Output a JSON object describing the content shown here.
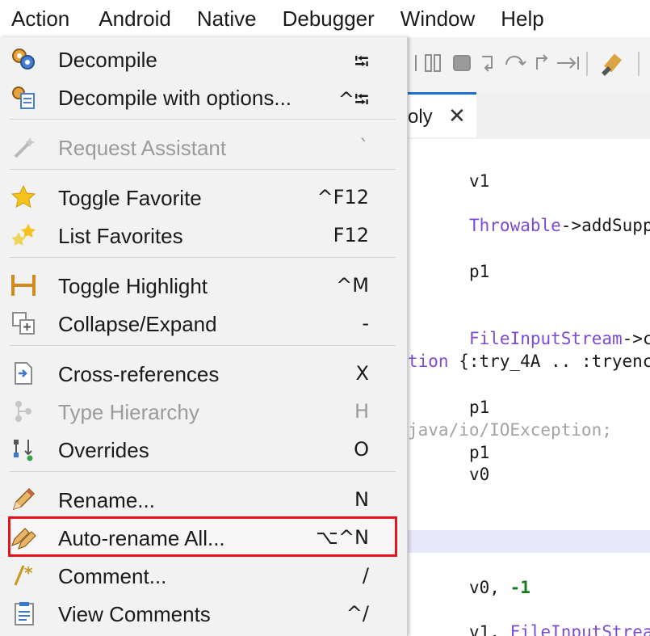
{
  "menubar": {
    "items": [
      "Action",
      "Android",
      "Native",
      "Debugger",
      "Window",
      "Help"
    ]
  },
  "tab": {
    "label": "oly",
    "close": "✕"
  },
  "editor": {
    "lines": {
      "l1": "v1",
      "l2a": "Throwable",
      "l2b": "->addSupp",
      "l3": "p1",
      "l4a": "FileInputStream",
      "l4b": "->c",
      "l5a": "tion",
      "l5b": " {:try_4A .. :tryenc",
      "l6": "p1",
      "l7": "java/io/IOException;",
      "l8": "p1",
      "l9": "v0",
      "l10a": "v0, ",
      "l10b": "-1",
      "l11a": "v1, ",
      "l11b": "FileInputStrea"
    }
  },
  "menu": {
    "items": [
      {
        "label": "Decompile",
        "shortcut": "⭾",
        "icon": "decompile-icon"
      },
      {
        "label": "Decompile with options...",
        "shortcut": "^⭾",
        "icon": "decompile-options-icon"
      },
      {
        "label": "Request Assistant",
        "shortcut": "`",
        "icon": "wand-icon",
        "disabled": true
      },
      {
        "label": "Toggle Favorite",
        "shortcut": "^F12",
        "icon": "star-icon"
      },
      {
        "label": "List Favorites",
        "shortcut": "F12",
        "icon": "stars-icon"
      },
      {
        "label": "Toggle Highlight",
        "shortcut": "^M",
        "icon": "highlight-icon"
      },
      {
        "label": "Collapse/Expand",
        "shortcut": "-",
        "icon": "collapse-expand-icon"
      },
      {
        "label": "Cross-references",
        "shortcut": "X",
        "icon": "cross-references-icon"
      },
      {
        "label": "Type Hierarchy",
        "shortcut": "H",
        "icon": "type-hierarchy-icon",
        "disabled": true
      },
      {
        "label": "Overrides",
        "shortcut": "O",
        "icon": "overrides-icon"
      },
      {
        "label": "Rename...",
        "shortcut": "N",
        "icon": "pencil-icon"
      },
      {
        "label": "Auto-rename All...",
        "shortcut": "⌥^N",
        "icon": "pencils-icon"
      },
      {
        "label": "Comment...",
        "shortcut": "/",
        "icon": "comment-icon"
      },
      {
        "label": "View Comments",
        "shortcut": "^/",
        "icon": "view-comments-icon"
      }
    ]
  },
  "colors": {
    "highlight_box": "#e3151a",
    "type_purple": "#7d4bd1",
    "number_green": "#1b7a1b",
    "tab_accent": "#1f6fd1"
  }
}
